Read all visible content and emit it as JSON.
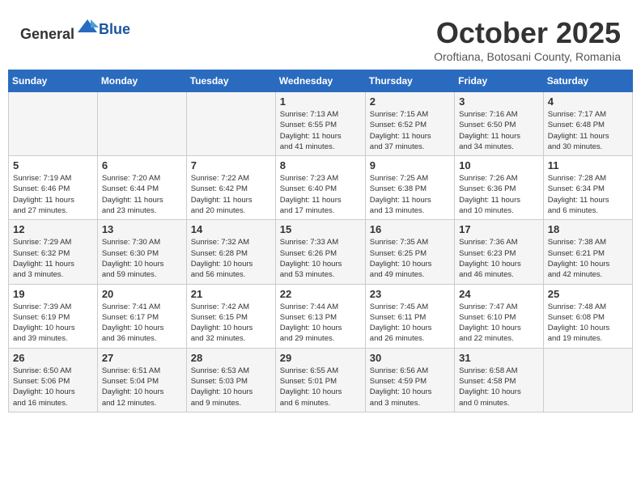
{
  "header": {
    "logo_general": "General",
    "logo_blue": "Blue",
    "month": "October 2025",
    "location": "Oroftiana, Botosani County, Romania"
  },
  "days_of_week": [
    "Sunday",
    "Monday",
    "Tuesday",
    "Wednesday",
    "Thursday",
    "Friday",
    "Saturday"
  ],
  "weeks": [
    [
      {
        "day": "",
        "info": ""
      },
      {
        "day": "",
        "info": ""
      },
      {
        "day": "",
        "info": ""
      },
      {
        "day": "1",
        "info": "Sunrise: 7:13 AM\nSunset: 6:55 PM\nDaylight: 11 hours\nand 41 minutes."
      },
      {
        "day": "2",
        "info": "Sunrise: 7:15 AM\nSunset: 6:52 PM\nDaylight: 11 hours\nand 37 minutes."
      },
      {
        "day": "3",
        "info": "Sunrise: 7:16 AM\nSunset: 6:50 PM\nDaylight: 11 hours\nand 34 minutes."
      },
      {
        "day": "4",
        "info": "Sunrise: 7:17 AM\nSunset: 6:48 PM\nDaylight: 11 hours\nand 30 minutes."
      }
    ],
    [
      {
        "day": "5",
        "info": "Sunrise: 7:19 AM\nSunset: 6:46 PM\nDaylight: 11 hours\nand 27 minutes."
      },
      {
        "day": "6",
        "info": "Sunrise: 7:20 AM\nSunset: 6:44 PM\nDaylight: 11 hours\nand 23 minutes."
      },
      {
        "day": "7",
        "info": "Sunrise: 7:22 AM\nSunset: 6:42 PM\nDaylight: 11 hours\nand 20 minutes."
      },
      {
        "day": "8",
        "info": "Sunrise: 7:23 AM\nSunset: 6:40 PM\nDaylight: 11 hours\nand 17 minutes."
      },
      {
        "day": "9",
        "info": "Sunrise: 7:25 AM\nSunset: 6:38 PM\nDaylight: 11 hours\nand 13 minutes."
      },
      {
        "day": "10",
        "info": "Sunrise: 7:26 AM\nSunset: 6:36 PM\nDaylight: 11 hours\nand 10 minutes."
      },
      {
        "day": "11",
        "info": "Sunrise: 7:28 AM\nSunset: 6:34 PM\nDaylight: 11 hours\nand 6 minutes."
      }
    ],
    [
      {
        "day": "12",
        "info": "Sunrise: 7:29 AM\nSunset: 6:32 PM\nDaylight: 11 hours\nand 3 minutes."
      },
      {
        "day": "13",
        "info": "Sunrise: 7:30 AM\nSunset: 6:30 PM\nDaylight: 10 hours\nand 59 minutes."
      },
      {
        "day": "14",
        "info": "Sunrise: 7:32 AM\nSunset: 6:28 PM\nDaylight: 10 hours\nand 56 minutes."
      },
      {
        "day": "15",
        "info": "Sunrise: 7:33 AM\nSunset: 6:26 PM\nDaylight: 10 hours\nand 53 minutes."
      },
      {
        "day": "16",
        "info": "Sunrise: 7:35 AM\nSunset: 6:25 PM\nDaylight: 10 hours\nand 49 minutes."
      },
      {
        "day": "17",
        "info": "Sunrise: 7:36 AM\nSunset: 6:23 PM\nDaylight: 10 hours\nand 46 minutes."
      },
      {
        "day": "18",
        "info": "Sunrise: 7:38 AM\nSunset: 6:21 PM\nDaylight: 10 hours\nand 42 minutes."
      }
    ],
    [
      {
        "day": "19",
        "info": "Sunrise: 7:39 AM\nSunset: 6:19 PM\nDaylight: 10 hours\nand 39 minutes."
      },
      {
        "day": "20",
        "info": "Sunrise: 7:41 AM\nSunset: 6:17 PM\nDaylight: 10 hours\nand 36 minutes."
      },
      {
        "day": "21",
        "info": "Sunrise: 7:42 AM\nSunset: 6:15 PM\nDaylight: 10 hours\nand 32 minutes."
      },
      {
        "day": "22",
        "info": "Sunrise: 7:44 AM\nSunset: 6:13 PM\nDaylight: 10 hours\nand 29 minutes."
      },
      {
        "day": "23",
        "info": "Sunrise: 7:45 AM\nSunset: 6:11 PM\nDaylight: 10 hours\nand 26 minutes."
      },
      {
        "day": "24",
        "info": "Sunrise: 7:47 AM\nSunset: 6:10 PM\nDaylight: 10 hours\nand 22 minutes."
      },
      {
        "day": "25",
        "info": "Sunrise: 7:48 AM\nSunset: 6:08 PM\nDaylight: 10 hours\nand 19 minutes."
      }
    ],
    [
      {
        "day": "26",
        "info": "Sunrise: 6:50 AM\nSunset: 5:06 PM\nDaylight: 10 hours\nand 16 minutes."
      },
      {
        "day": "27",
        "info": "Sunrise: 6:51 AM\nSunset: 5:04 PM\nDaylight: 10 hours\nand 12 minutes."
      },
      {
        "day": "28",
        "info": "Sunrise: 6:53 AM\nSunset: 5:03 PM\nDaylight: 10 hours\nand 9 minutes."
      },
      {
        "day": "29",
        "info": "Sunrise: 6:55 AM\nSunset: 5:01 PM\nDaylight: 10 hours\nand 6 minutes."
      },
      {
        "day": "30",
        "info": "Sunrise: 6:56 AM\nSunset: 4:59 PM\nDaylight: 10 hours\nand 3 minutes."
      },
      {
        "day": "31",
        "info": "Sunrise: 6:58 AM\nSunset: 4:58 PM\nDaylight: 10 hours\nand 0 minutes."
      },
      {
        "day": "",
        "info": ""
      }
    ]
  ]
}
